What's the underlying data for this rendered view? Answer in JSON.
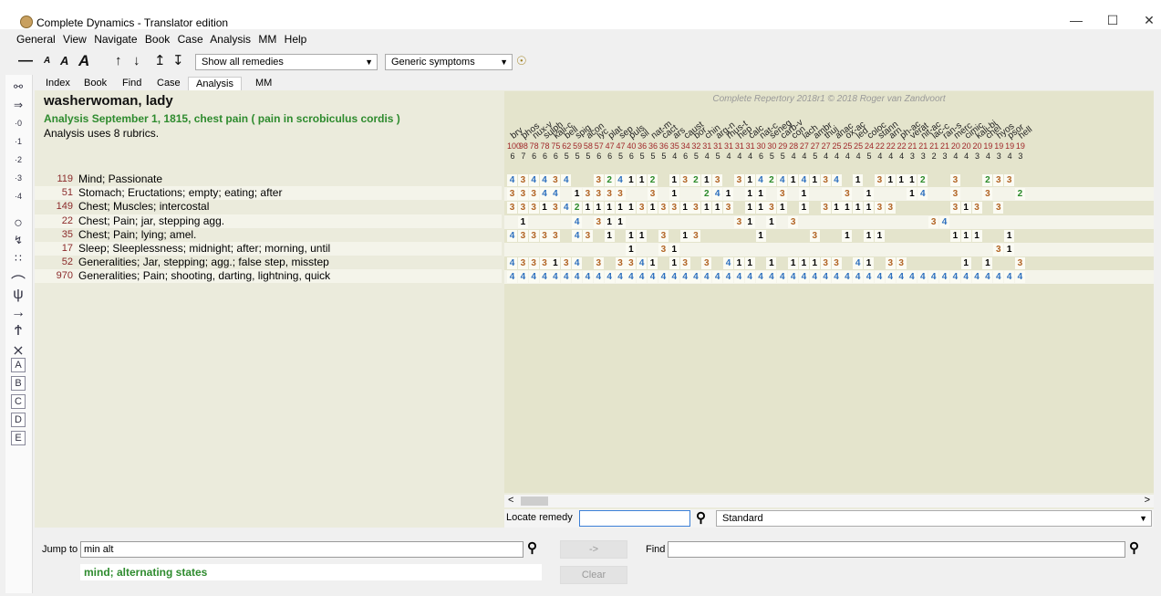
{
  "window": {
    "title": "Complete Dynamics - Translator edition",
    "minimize": "—",
    "maximize": "☐",
    "close": "✕"
  },
  "menu": [
    "General",
    "View",
    "Navigate",
    "Book",
    "Case",
    "Analysis",
    "MM",
    "Help"
  ],
  "toolbar": {
    "remedy_filter": "Show all remedies",
    "symptom_filter": "Generic symptoms"
  },
  "leftbar": {
    "letters": [
      "A",
      "B",
      "C",
      "D",
      "E"
    ],
    "degrees": [
      "0",
      "1",
      "2",
      "3",
      "4"
    ]
  },
  "tabs": [
    "Index",
    "Book",
    "Find",
    "Case",
    "Analysis",
    "MM"
  ],
  "case": {
    "title": "washerwoman, lady",
    "analysis_title": "Analysis September 1, 1815, chest pain ( pain in scrobiculus cordis )",
    "rubric_count_text": "Analysis uses 8 rubrics."
  },
  "grid": {
    "copyright": "Complete Repertory 2018r1 © 2018 Roger van Zandvoort",
    "remedies": [
      "bry",
      "phos",
      "nux-v",
      "sulph",
      "kali-c",
      "bell",
      "spig",
      "acon",
      "lyc",
      "plat",
      "sep",
      "puls",
      "sil",
      "nat-m",
      "cact",
      "ars",
      "caust",
      "bor",
      "chin",
      "arg-n",
      "rhus-t",
      "hep",
      "calc",
      "nat-c",
      "seneg",
      "carb-v",
      "con",
      "lach",
      "ambr",
      "thuj",
      "anac",
      "ox-ac",
      "led",
      "coloc",
      "stann",
      "arn",
      "ph-ac",
      "verat",
      "nit-ac",
      "lac-c",
      "ran-s",
      "merc",
      "cimic",
      "kali-bi",
      "chel",
      "hyos",
      "psor",
      "hell"
    ],
    "scores": [
      "100",
      "98",
      "78",
      "78",
      "75",
      "62",
      "59",
      "58",
      "57",
      "47",
      "47",
      "40",
      "36",
      "36",
      "36",
      "35",
      "34",
      "32",
      "31",
      "31",
      "31",
      "31",
      "31",
      "30",
      "30",
      "29",
      "28",
      "27",
      "27",
      "27",
      "25",
      "25",
      "25",
      "24",
      "22",
      "22",
      "22",
      "21",
      "21",
      "21",
      "21",
      "20",
      "20",
      "20",
      "19",
      "19",
      "19",
      "19"
    ],
    "hits": [
      "6",
      "7",
      "6",
      "6",
      "6",
      "5",
      "5",
      "5",
      "6",
      "6",
      "5",
      "6",
      "5",
      "5",
      "5",
      "4",
      "6",
      "5",
      "4",
      "5",
      "4",
      "4",
      "4",
      "6",
      "5",
      "5",
      "4",
      "4",
      "5",
      "4",
      "4",
      "4",
      "4",
      "5",
      "4",
      "4",
      "4",
      "3",
      "3",
      "2",
      "3",
      "4",
      "4",
      "3",
      "4",
      "3",
      "4",
      "3"
    ]
  },
  "rubrics": [
    {
      "count": "119",
      "text": "Mind; Passionate"
    },
    {
      "count": "51",
      "text": "Stomach; Eructations; empty; eating; after"
    },
    {
      "count": "149",
      "text": "Chest; Muscles; intercostal"
    },
    {
      "count": "22",
      "text": "Chest; Pain; jar, stepping agg."
    },
    {
      "count": "35",
      "text": "Chest; Pain; lying; amel."
    },
    {
      "count": "17",
      "text": "Sleep; Sleeplessness; midnight; after; morning, until"
    },
    {
      "count": "52",
      "text": "Generalities; Jar, stepping; agg.; false step, misstep"
    },
    {
      "count": "970",
      "text": "Generalities; Pain; shooting, darting, lightning, quick"
    }
  ],
  "cells": [
    [
      "4",
      "3",
      "4",
      "4",
      "3",
      "4",
      "",
      "",
      "3",
      "2",
      "4",
      "1",
      "1",
      "2",
      "",
      "1",
      "3",
      "2",
      "1",
      "3",
      "",
      "3",
      "1",
      "4",
      "2",
      "4",
      "1",
      "4",
      "1",
      "3",
      "4",
      "",
      "1",
      "",
      "3",
      "1",
      "1",
      "1",
      "2",
      "",
      "",
      "3",
      "",
      "",
      "2",
      "3",
      "3",
      ""
    ],
    [
      "3",
      "3",
      "3",
      "4",
      "4",
      "",
      "1",
      "3",
      "3",
      "3",
      "3",
      "",
      "",
      "3",
      "",
      "1",
      "",
      "",
      "2",
      "4",
      "1",
      "",
      "1",
      "1",
      "",
      "3",
      "",
      "1",
      "",
      "",
      "",
      "3",
      "",
      "1",
      "",
      "",
      "",
      "1",
      "4",
      "",
      "",
      "3",
      "",
      "",
      "3",
      "",
      "",
      "2"
    ],
    [
      "3",
      "3",
      "3",
      "1",
      "3",
      "4",
      "2",
      "1",
      "1",
      "1",
      "1",
      "1",
      "3",
      "1",
      "3",
      "3",
      "1",
      "3",
      "1",
      "1",
      "3",
      "",
      "1",
      "1",
      "3",
      "1",
      "",
      "1",
      "",
      "3",
      "1",
      "1",
      "1",
      "1",
      "3",
      "3",
      "",
      "",
      "",
      "",
      "",
      "3",
      "1",
      "3",
      "",
      "3",
      "",
      ""
    ],
    [
      "",
      "1",
      "",
      "",
      "",
      "",
      "4",
      "",
      "3",
      "1",
      "1",
      "",
      "",
      "",
      "",
      "",
      "",
      "",
      "",
      "",
      "",
      "3",
      "1",
      "",
      "1",
      "",
      "3",
      "",
      "",
      "",
      "",
      "",
      "",
      "",
      "",
      "",
      "",
      "",
      "",
      "3",
      "4",
      "",
      "",
      "",
      "",
      "",
      "",
      ""
    ],
    [
      "4",
      "3",
      "3",
      "3",
      "3",
      "",
      "4",
      "3",
      "",
      "1",
      "",
      "1",
      "1",
      "",
      "3",
      "",
      "1",
      "3",
      "",
      "",
      "",
      "",
      "",
      "1",
      "",
      "",
      "",
      "",
      "3",
      "",
      "",
      "1",
      "",
      "1",
      "1",
      "",
      "",
      "",
      "",
      "",
      "",
      "1",
      "1",
      "1",
      "",
      "",
      "1",
      ""
    ],
    [
      "",
      "",
      "",
      "",
      "",
      "",
      "",
      "",
      "",
      "",
      "",
      "1",
      "",
      "",
      "3",
      "1",
      "",
      "",
      "",
      "",
      "",
      "",
      "",
      "",
      "",
      "",
      "",
      "",
      "",
      "",
      "",
      "",
      "",
      "",
      "",
      "",
      "",
      "",
      "",
      "",
      "",
      "",
      "",
      "",
      "",
      "3",
      "1",
      ""
    ],
    [
      "4",
      "3",
      "3",
      "3",
      "1",
      "3",
      "4",
      "",
      "3",
      "",
      "3",
      "3",
      "4",
      "1",
      "",
      "1",
      "3",
      "",
      "3",
      "",
      "4",
      "1",
      "1",
      "",
      "1",
      "",
      "1",
      "1",
      "1",
      "3",
      "3",
      "",
      "4",
      "1",
      "",
      "3",
      "3",
      "",
      "",
      "",
      "",
      "",
      "1",
      "",
      "1",
      "",
      "",
      "3"
    ],
    [
      "4",
      "4",
      "4",
      "4",
      "4",
      "4",
      "4",
      "4",
      "4",
      "4",
      "4",
      "4",
      "4",
      "4",
      "4",
      "4",
      "4",
      "4",
      "4",
      "4",
      "4",
      "4",
      "4",
      "4",
      "4",
      "4",
      "4",
      "4",
      "4",
      "4",
      "4",
      "4",
      "4",
      "4",
      "4",
      "4",
      "4",
      "4",
      "4",
      "4",
      "4",
      "4",
      "4",
      "4",
      "4",
      "4",
      "4",
      "4"
    ]
  ],
  "locate": {
    "label": "Locate remedy",
    "value": "",
    "method": "Standard"
  },
  "bottom": {
    "jump_label": "Jump to",
    "jump_value": "min alt",
    "jump_button": "->",
    "clear_button": "Clear",
    "find_label": "Find",
    "find_value": "",
    "suggestion": "mind; alternating states"
  }
}
